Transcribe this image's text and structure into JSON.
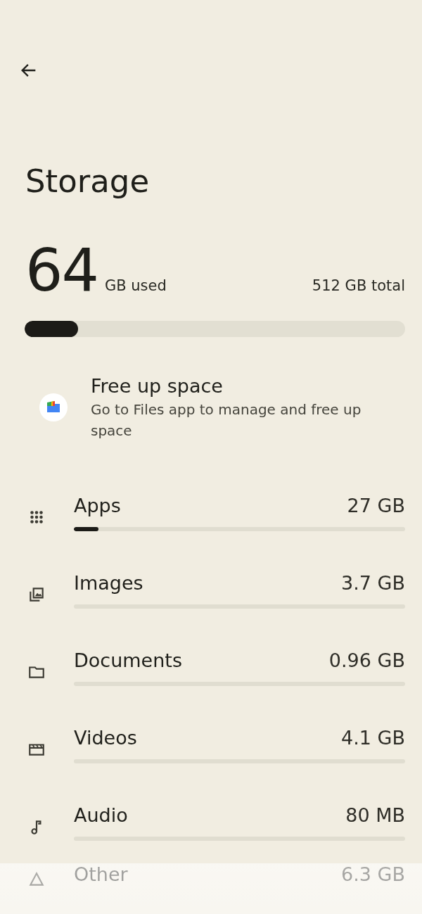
{
  "title": "Storage",
  "usage": {
    "used_amount": "64",
    "used_label": "GB used",
    "total": "512 GB total",
    "level": 0.14
  },
  "free_up": {
    "title": "Free up space",
    "subtitle": "Go to Files app to manage and free up space"
  },
  "categories": [
    {
      "kind": "apps",
      "name": "Apps",
      "size": "27 GB",
      "level": 0.075
    },
    {
      "kind": "images",
      "name": "Images",
      "size": "3.7 GB",
      "level": 0
    },
    {
      "kind": "documents",
      "name": "Documents",
      "size": "0.96 GB",
      "level": 0
    },
    {
      "kind": "videos",
      "name": "Videos",
      "size": "4.1 GB",
      "level": 0
    },
    {
      "kind": "audio",
      "name": "Audio",
      "size": "80 MB",
      "level": 0
    },
    {
      "kind": "other",
      "name": "Other",
      "size": "6.3 GB"
    }
  ]
}
